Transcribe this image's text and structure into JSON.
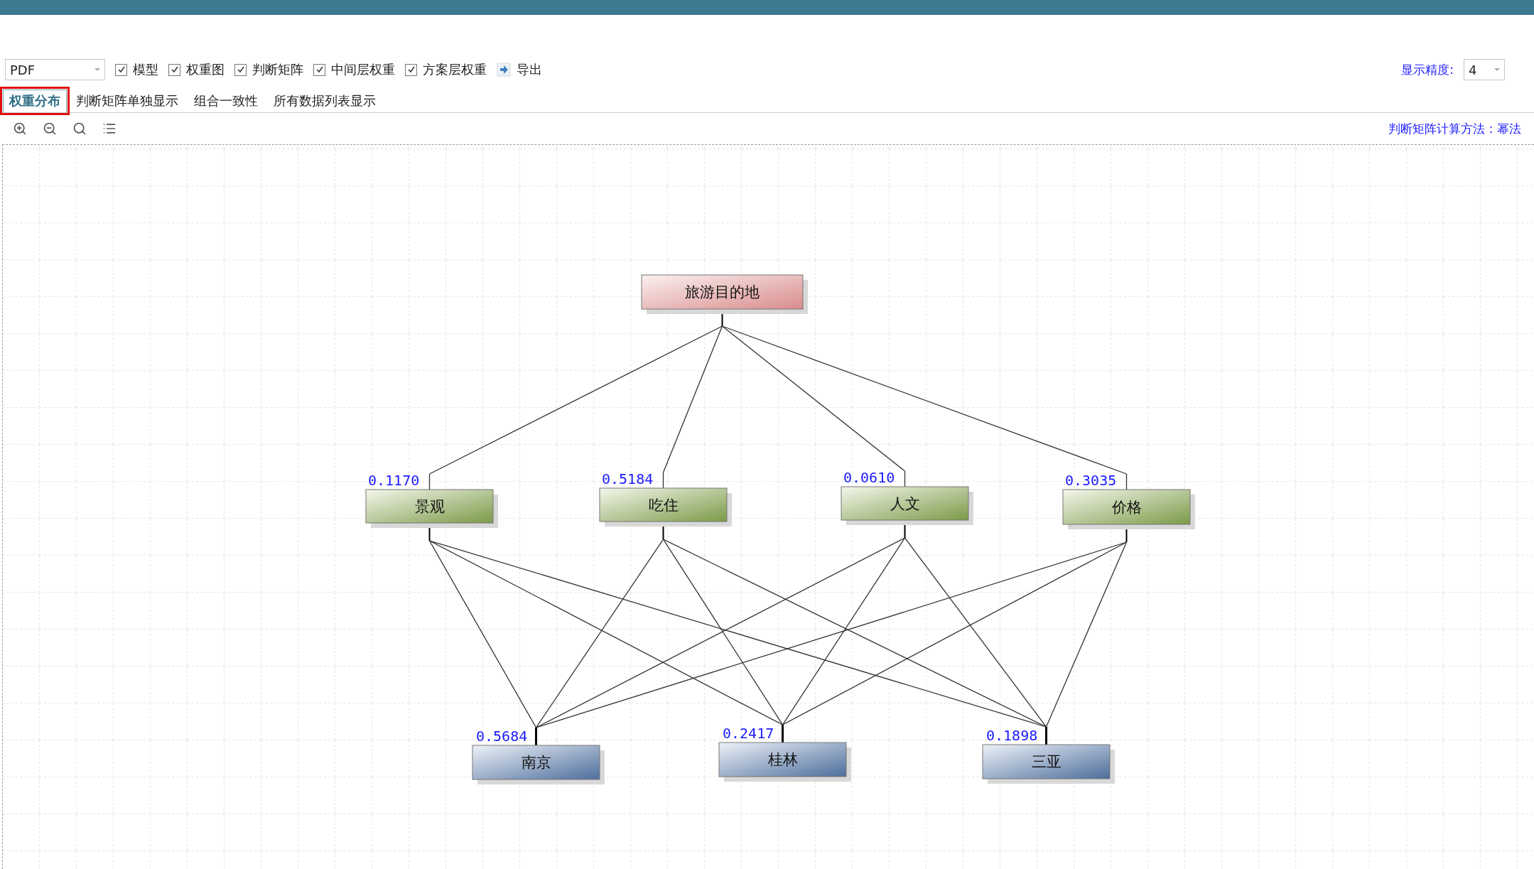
{
  "toolbar": {
    "format_select": {
      "value": "PDF"
    },
    "checkboxes": [
      {
        "label": "模型",
        "checked": true
      },
      {
        "label": "权重图",
        "checked": true
      },
      {
        "label": "判断矩阵",
        "checked": true
      },
      {
        "label": "中间层权重",
        "checked": true
      },
      {
        "label": "方案层权重",
        "checked": true
      }
    ],
    "export_button": {
      "label": "导出"
    },
    "precision": {
      "label": "显示精度:",
      "value": "4"
    }
  },
  "tabs": [
    {
      "label": "权重分布",
      "selected": true,
      "highlighted": true
    },
    {
      "label": "判断矩阵单独显示",
      "selected": false,
      "highlighted": false
    },
    {
      "label": "组合一致性",
      "selected": false,
      "highlighted": false
    },
    {
      "label": "所有数据列表显示",
      "selected": false,
      "highlighted": false
    }
  ],
  "method_label": "判断矩阵计算方法：幂法",
  "diagram": {
    "goal": {
      "label": "旅游目的地"
    },
    "criteria": [
      {
        "label": "景观",
        "weight": "0.1170"
      },
      {
        "label": "吃住",
        "weight": "0.5184"
      },
      {
        "label": "人文",
        "weight": "0.0610"
      },
      {
        "label": "价格",
        "weight": "0.3035"
      }
    ],
    "alternatives": [
      {
        "label": "南京",
        "weight": "0.5684"
      },
      {
        "label": "桂林",
        "weight": "0.2417"
      },
      {
        "label": "三亚",
        "weight": "0.1898"
      }
    ]
  }
}
